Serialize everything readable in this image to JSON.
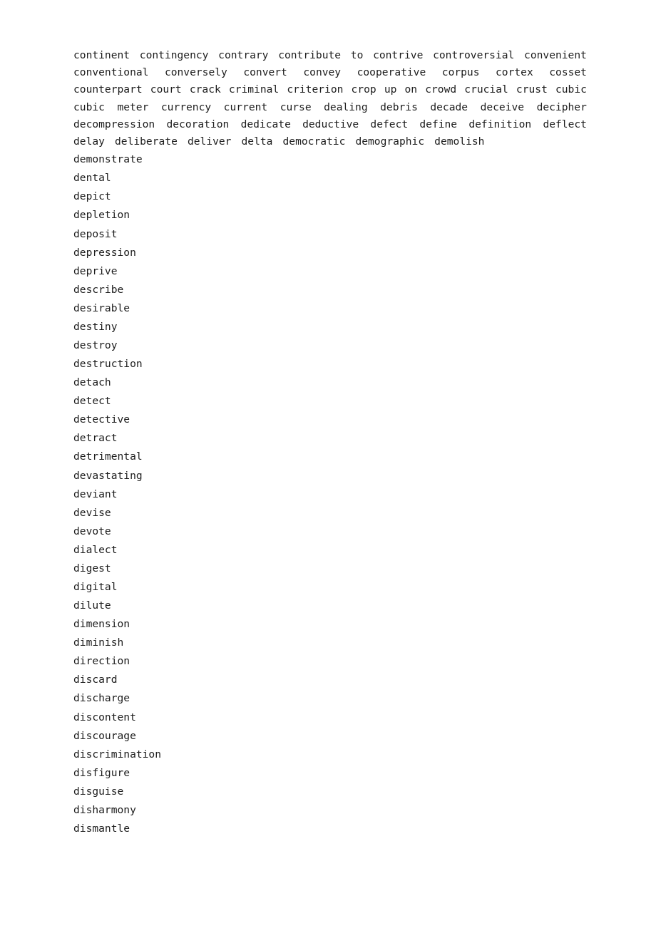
{
  "document": {
    "background_color": "#ffffff",
    "text_color": "#1d1d1d",
    "paragraph_lines": [
      {
        "id": "line-1",
        "justified": true,
        "words": [
          "continent",
          "contingency",
          "contrary",
          "contribute",
          "to",
          "contrive",
          "controversial",
          "convenient"
        ]
      },
      {
        "id": "line-2",
        "justified": true,
        "words": [
          "conventional",
          "conversely",
          "convert",
          "convey",
          "cooperative",
          "corpus",
          "cortex",
          "cosset"
        ]
      },
      {
        "id": "line-3",
        "justified": true,
        "words": [
          "counterpart",
          "court",
          "crack",
          "criminal",
          "criterion",
          "crop",
          "up",
          "on",
          "crowd",
          "crucial",
          "crust",
          "cubic"
        ]
      },
      {
        "id": "line-4",
        "justified": true,
        "words": [
          "cubic",
          "meter",
          "currency",
          "current",
          "curse",
          "dealing",
          "debris",
          "decade",
          "deceive",
          "decipher"
        ]
      },
      {
        "id": "line-5",
        "justified": true,
        "words": [
          "decompression",
          "decoration",
          "dedicate",
          "deductive",
          "defect",
          "define",
          "definition",
          "deflect"
        ]
      },
      {
        "id": "line-6",
        "justified": false,
        "words": [
          "delay",
          "deliberate",
          "deliver",
          "delta",
          "democratic",
          "demographic",
          "demolish"
        ]
      }
    ],
    "list_items": [
      "demonstrate",
      "dental",
      "depict",
      "depletion",
      "deposit",
      "depression",
      "deprive",
      "describe",
      "desirable",
      "destiny",
      "destroy",
      "destruction",
      "detach",
      "detect",
      "detective",
      "detract",
      "detrimental",
      "devastating",
      "deviant",
      "devise",
      "devote",
      "dialect",
      "digest",
      "digital",
      "dilute",
      "dimension",
      "diminish",
      "direction",
      "discard",
      "discharge",
      "discontent",
      "discourage",
      "discrimination",
      "disfigure",
      "disguise",
      "disharmony",
      "dismantle"
    ]
  }
}
